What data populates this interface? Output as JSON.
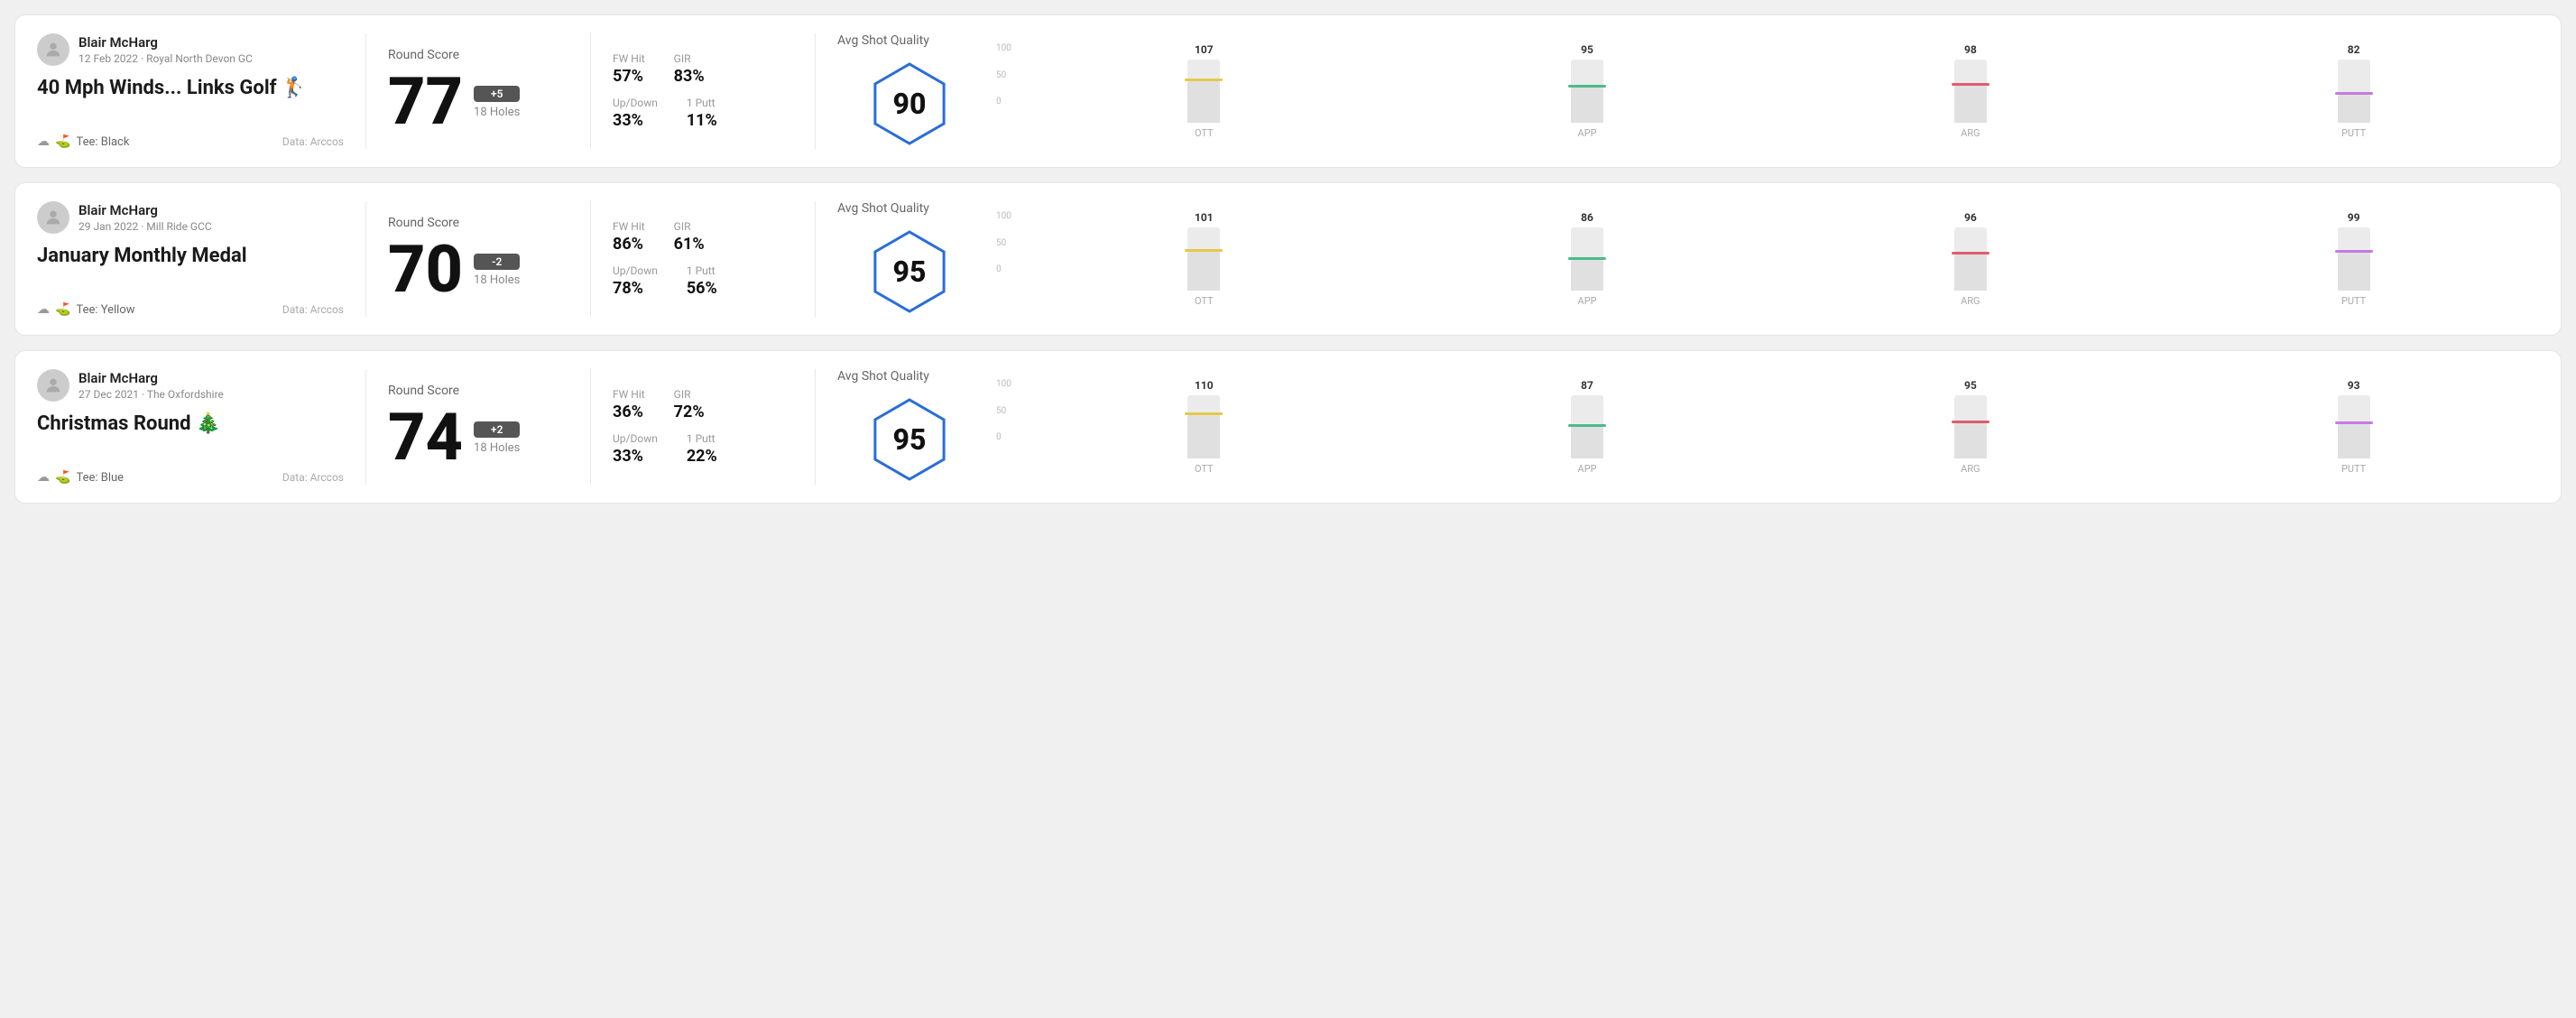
{
  "rounds": [
    {
      "id": "round-1",
      "player": {
        "name": "Blair McHarg",
        "date_course": "12 Feb 2022 · Royal North Devon GC"
      },
      "title": "40 Mph Winds... Links Golf 🏌",
      "tee": "Black",
      "data_source": "Data: Arccos",
      "score": {
        "label": "Round Score",
        "number": "77",
        "diff": "+5",
        "holes": "18 Holes"
      },
      "stats": {
        "fw_hit_label": "FW Hit",
        "fw_hit_value": "57%",
        "gir_label": "GIR",
        "gir_value": "83%",
        "up_down_label": "Up/Down",
        "up_down_value": "33%",
        "one_putt_label": "1 Putt",
        "one_putt_value": "11%"
      },
      "quality": {
        "label": "Avg Shot Quality",
        "score": "90"
      },
      "chart": {
        "bars": [
          {
            "label": "OTT",
            "value": 107,
            "color": "#e6c84a",
            "bar_pct": 65
          },
          {
            "label": "APP",
            "value": 95,
            "color": "#4cbb8a",
            "bar_pct": 55
          },
          {
            "label": "ARG",
            "value": 98,
            "color": "#e05c6e",
            "bar_pct": 58
          },
          {
            "label": "PUTT",
            "value": 82,
            "color": "#c47be0",
            "bar_pct": 45
          }
        ]
      }
    },
    {
      "id": "round-2",
      "player": {
        "name": "Blair McHarg",
        "date_course": "29 Jan 2022 · Mill Ride GCC"
      },
      "title": "January Monthly Medal",
      "tee": "Yellow",
      "data_source": "Data: Arccos",
      "score": {
        "label": "Round Score",
        "number": "70",
        "diff": "-2",
        "holes": "18 Holes"
      },
      "stats": {
        "fw_hit_label": "FW Hit",
        "fw_hit_value": "86%",
        "gir_label": "GIR",
        "gir_value": "61%",
        "up_down_label": "Up/Down",
        "up_down_value": "78%",
        "one_putt_label": "1 Putt",
        "one_putt_value": "56%"
      },
      "quality": {
        "label": "Avg Shot Quality",
        "score": "95"
      },
      "chart": {
        "bars": [
          {
            "label": "OTT",
            "value": 101,
            "color": "#e6c84a",
            "bar_pct": 62
          },
          {
            "label": "APP",
            "value": 86,
            "color": "#4cbb8a",
            "bar_pct": 48
          },
          {
            "label": "ARG",
            "value": 96,
            "color": "#e05c6e",
            "bar_pct": 57
          },
          {
            "label": "PUTT",
            "value": 99,
            "color": "#c47be0",
            "bar_pct": 60
          }
        ]
      }
    },
    {
      "id": "round-3",
      "player": {
        "name": "Blair McHarg",
        "date_course": "27 Dec 2021 · The Oxfordshire"
      },
      "title": "Christmas Round 🎄",
      "tee": "Blue",
      "data_source": "Data: Arccos",
      "score": {
        "label": "Round Score",
        "number": "74",
        "diff": "+2",
        "holes": "18 Holes"
      },
      "stats": {
        "fw_hit_label": "FW Hit",
        "fw_hit_value": "36%",
        "gir_label": "GIR",
        "gir_value": "72%",
        "up_down_label": "Up/Down",
        "up_down_value": "33%",
        "one_putt_label": "1 Putt",
        "one_putt_value": "22%"
      },
      "quality": {
        "label": "Avg Shot Quality",
        "score": "95"
      },
      "chart": {
        "bars": [
          {
            "label": "OTT",
            "value": 110,
            "color": "#e6c84a",
            "bar_pct": 68
          },
          {
            "label": "APP",
            "value": 87,
            "color": "#4cbb8a",
            "bar_pct": 50
          },
          {
            "label": "ARG",
            "value": 95,
            "color": "#e05c6e",
            "bar_pct": 56
          },
          {
            "label": "PUTT",
            "value": 93,
            "color": "#c47be0",
            "bar_pct": 54
          }
        ]
      }
    }
  ],
  "y_axis": {
    "top": "100",
    "mid": "50",
    "bot": "0"
  }
}
